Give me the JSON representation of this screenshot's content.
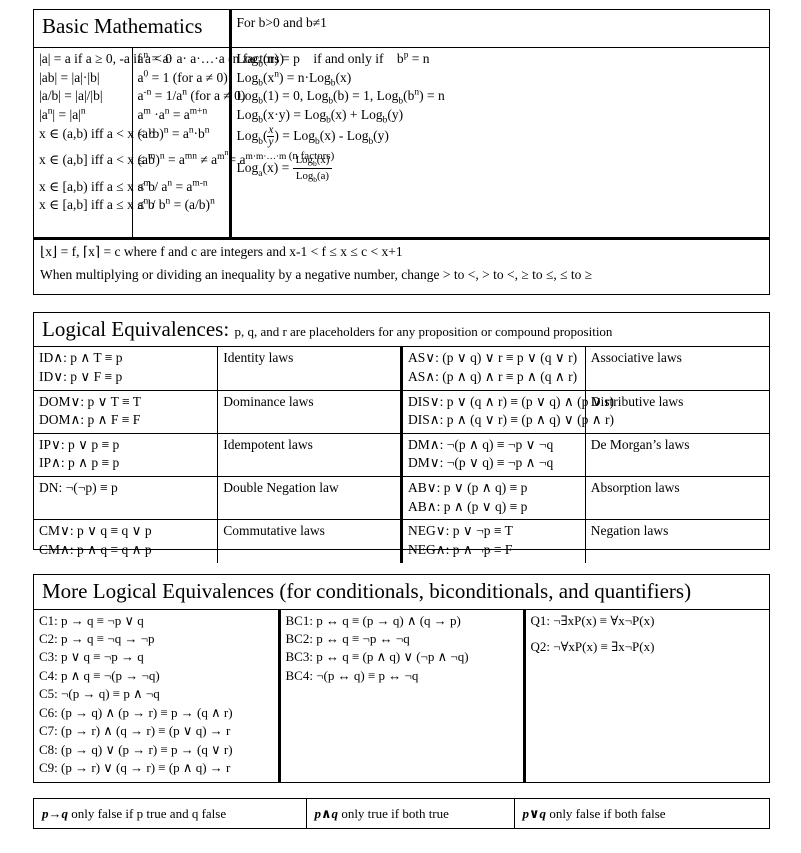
{
  "basic_math": {
    "title": "Basic Mathematics",
    "log_condition": "For b>0 and b≠1",
    "absolute_value": [
      "|a| = a if a ≥ 0, -a if a < 0",
      "|ab| = |a|·|b|",
      "|a/b| = |a|/|b|",
      "|aⁿ| = |a|ⁿ",
      "x ∈ (a,b) iff a < x < b",
      "x ∈ (a,b] iff a < x ≤ b",
      "x ∈ [a,b) iff a ≤ x < b",
      "x ∈ [a,b] iff a ≤ x ≤ b"
    ],
    "exponents": [
      "aⁿ = a· a· a·…·a (n factors)",
      "a⁰ = 1 (for a ≠ 0)",
      "a⁻ⁿ = 1/aⁿ (for a ≠ 0)",
      "aᵐ ·aⁿ = aᵐ⁺ⁿ",
      "(a·b)ⁿ = aⁿ·bⁿ",
      "(aᵐ)ⁿ = aᵐⁿ ≠ aᵐⁿ = aᵐ·ᵐ·…·ᵐ (n factors)",
      "aᵐ / aⁿ = aᵐ⁻ⁿ",
      "aⁿ / bⁿ = (a/b)ⁿ"
    ],
    "logarithms": [
      "Logₕ(n) = p    if and only if    bᵖ = n",
      "Logₕ(xⁿ) = n·Logₕ(x)",
      "Logₕ(1) = 0, Logₕ(b) = 1, Logₕ(bⁿ) = n",
      "Logₕ(x·y) = Logₕ(x) + Logₕ(y)",
      "Logₕ(x/y) = Logₕ(x) - Logₕ(y)",
      "Logₐ(x) = Logₕ(x) / Logₕ(a)"
    ],
    "floor_ceiling": "⌊x⌋ = f, ⌈x⌉ = c where f and c are integers and x-1 < f ≤ x ≤ c < x+1",
    "inequality_note": "When multiplying or dividing an inequality by a negative number, change > to <, > to <, ≥ to ≤, ≤ to ≥"
  },
  "logical_equivalences": {
    "title": "Logical Equivalences:",
    "subtitle": "p, q, and r are placeholders for any proposition or compound proposition",
    "rows": [
      {
        "left_lines": [
          "ID∧: p ∧ T ≡ p",
          "ID∨: p ∨ F ≡ p"
        ],
        "left_name": "Identity laws",
        "right_lines": [
          "AS∨: (p ∨ q) ∨ r ≡ p ∨ (q ∨ r)",
          "AS∧: (p ∧ q) ∧ r ≡ p ∧ (q ∧ r)"
        ],
        "right_name": "Associative laws"
      },
      {
        "left_lines": [
          "DOM∨: p ∨ T ≡ T",
          "DOM∧: p ∧ F ≡ F"
        ],
        "left_name": "Dominance laws",
        "right_lines": [
          "DIS∨: p ∨ (q ∧ r) ≡ (p ∨ q) ∧ (p ∨ r)",
          "DIS∧: p ∧ (q ∨ r) ≡ (p ∧ q) ∨ (p ∧ r)"
        ],
        "right_name": "Distributive laws"
      },
      {
        "left_lines": [
          "IP∨: p ∨ p ≡ p",
          "IP∧: p ∧ p ≡ p"
        ],
        "left_name": "Idempotent laws",
        "right_lines": [
          "DM∧: ¬(p ∧ q) ≡ ¬p ∨ ¬q",
          "DM∨: ¬(p ∨ q) ≡ ¬p ∧ ¬q"
        ],
        "right_name": "De Morgan’s laws"
      },
      {
        "left_lines": [
          "DN: ¬(¬p) ≡ p"
        ],
        "left_name": "Double Negation law",
        "right_lines": [
          "AB∨: p ∨ (p ∧ q) ≡ p",
          "AB∧: p ∧ (p ∨ q) ≡ p"
        ],
        "right_name": "Absorption laws"
      },
      {
        "left_lines": [
          "CM∨: p ∨ q ≡ q ∨ p",
          "CM∧: p ∧ q ≡ q ∧ p"
        ],
        "left_name": "Commutative laws",
        "right_lines": [
          "NEG∨: p ∨ ¬p ≡ T",
          "NEG∧: p ∧ ¬p ≡ F"
        ],
        "right_name": "Negation laws"
      }
    ]
  },
  "more_equivalences": {
    "title": "More Logical Equivalences (for conditionals, biconditionals, and quantifiers)",
    "conditionals": [
      "C1: p → q ≡ ¬p ∨ q",
      "C2: p → q ≡ ¬q → ¬p",
      "C3: p ∨ q ≡ ¬p → q",
      "C4: p ∧ q ≡ ¬(p → ¬q)",
      "C5: ¬(p → q) ≡ p ∧ ¬q",
      "C6: (p → q) ∧ (p → r) ≡ p → (q ∧ r)",
      "C7: (p → r) ∧ (q → r) ≡ (p ∨ q) → r",
      "C8: (p → q) ∨ (p → r) ≡ p → (q ∨ r)",
      "C9: (p → r) ∨ (q → r) ≡ (p ∧ q) → r"
    ],
    "biconditionals": [
      "BC1: p ↔ q ≡ (p → q) ∧ (q → p)",
      "BC2: p ↔ q ≡  ¬p ↔ ¬q",
      "BC3: p ↔ q ≡ (p ∧ q) ∨ (¬p ∧ ¬q)",
      "BC4: ¬(p ↔ q) ≡  p ↔ ¬q"
    ],
    "quantifiers": [
      "Q1: ¬∃xP(x) ≡ ∀x¬P(x)",
      "Q2: ¬∀xP(x) ≡ ∃x¬P(x)"
    ]
  },
  "footer": {
    "cells": [
      {
        "op": "p→q",
        "text": " only false if p true and q false"
      },
      {
        "op": "p∧q",
        "text": " only true if both true"
      },
      {
        "op": "p∨q",
        "text": " only false if both false"
      }
    ]
  }
}
